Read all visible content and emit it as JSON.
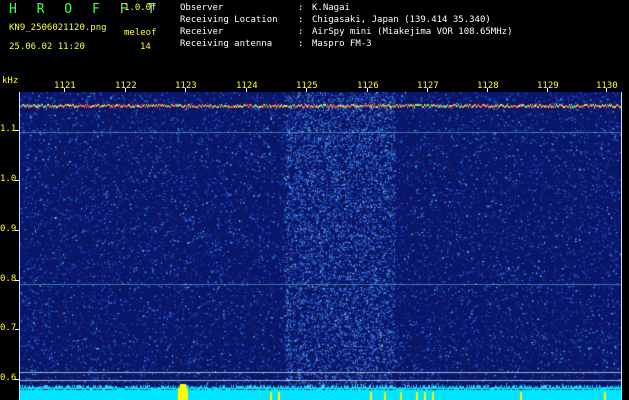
{
  "header": {
    "app_title": "H R O F F T",
    "version": "1.0.0f",
    "filename": "KN9_2506021120.png",
    "timestamp": "25.06.02 11:20",
    "mode_label": "meleof",
    "mode_value": "14"
  },
  "station_info": [
    {
      "key": "Observer",
      "value": "K.Nagai"
    },
    {
      "key": "Receiving Location",
      "value": "Chigasaki, Japan (139.414 35.340)"
    },
    {
      "key": "Receiver",
      "value": "AirSpy mini (Miakejima VOR 108.65MHz)"
    },
    {
      "key": "Receiving antenna",
      "value": "Maspro FM-3"
    }
  ],
  "axes": {
    "y_unit": "kHz",
    "y_ticks": [
      "1.1",
      "1.0",
      "0.9",
      "0.8",
      "0.7",
      "0.6"
    ],
    "x_ticks": [
      "1121",
      "1122",
      "1123",
      "1124",
      "1125",
      "1126",
      "1127",
      "1128",
      "1129",
      "1130"
    ]
  },
  "colors": {
    "background": "#0a1668",
    "carrier": "#ff7a3a",
    "signal": "#00e5ff",
    "peak": "#ffff00"
  }
}
